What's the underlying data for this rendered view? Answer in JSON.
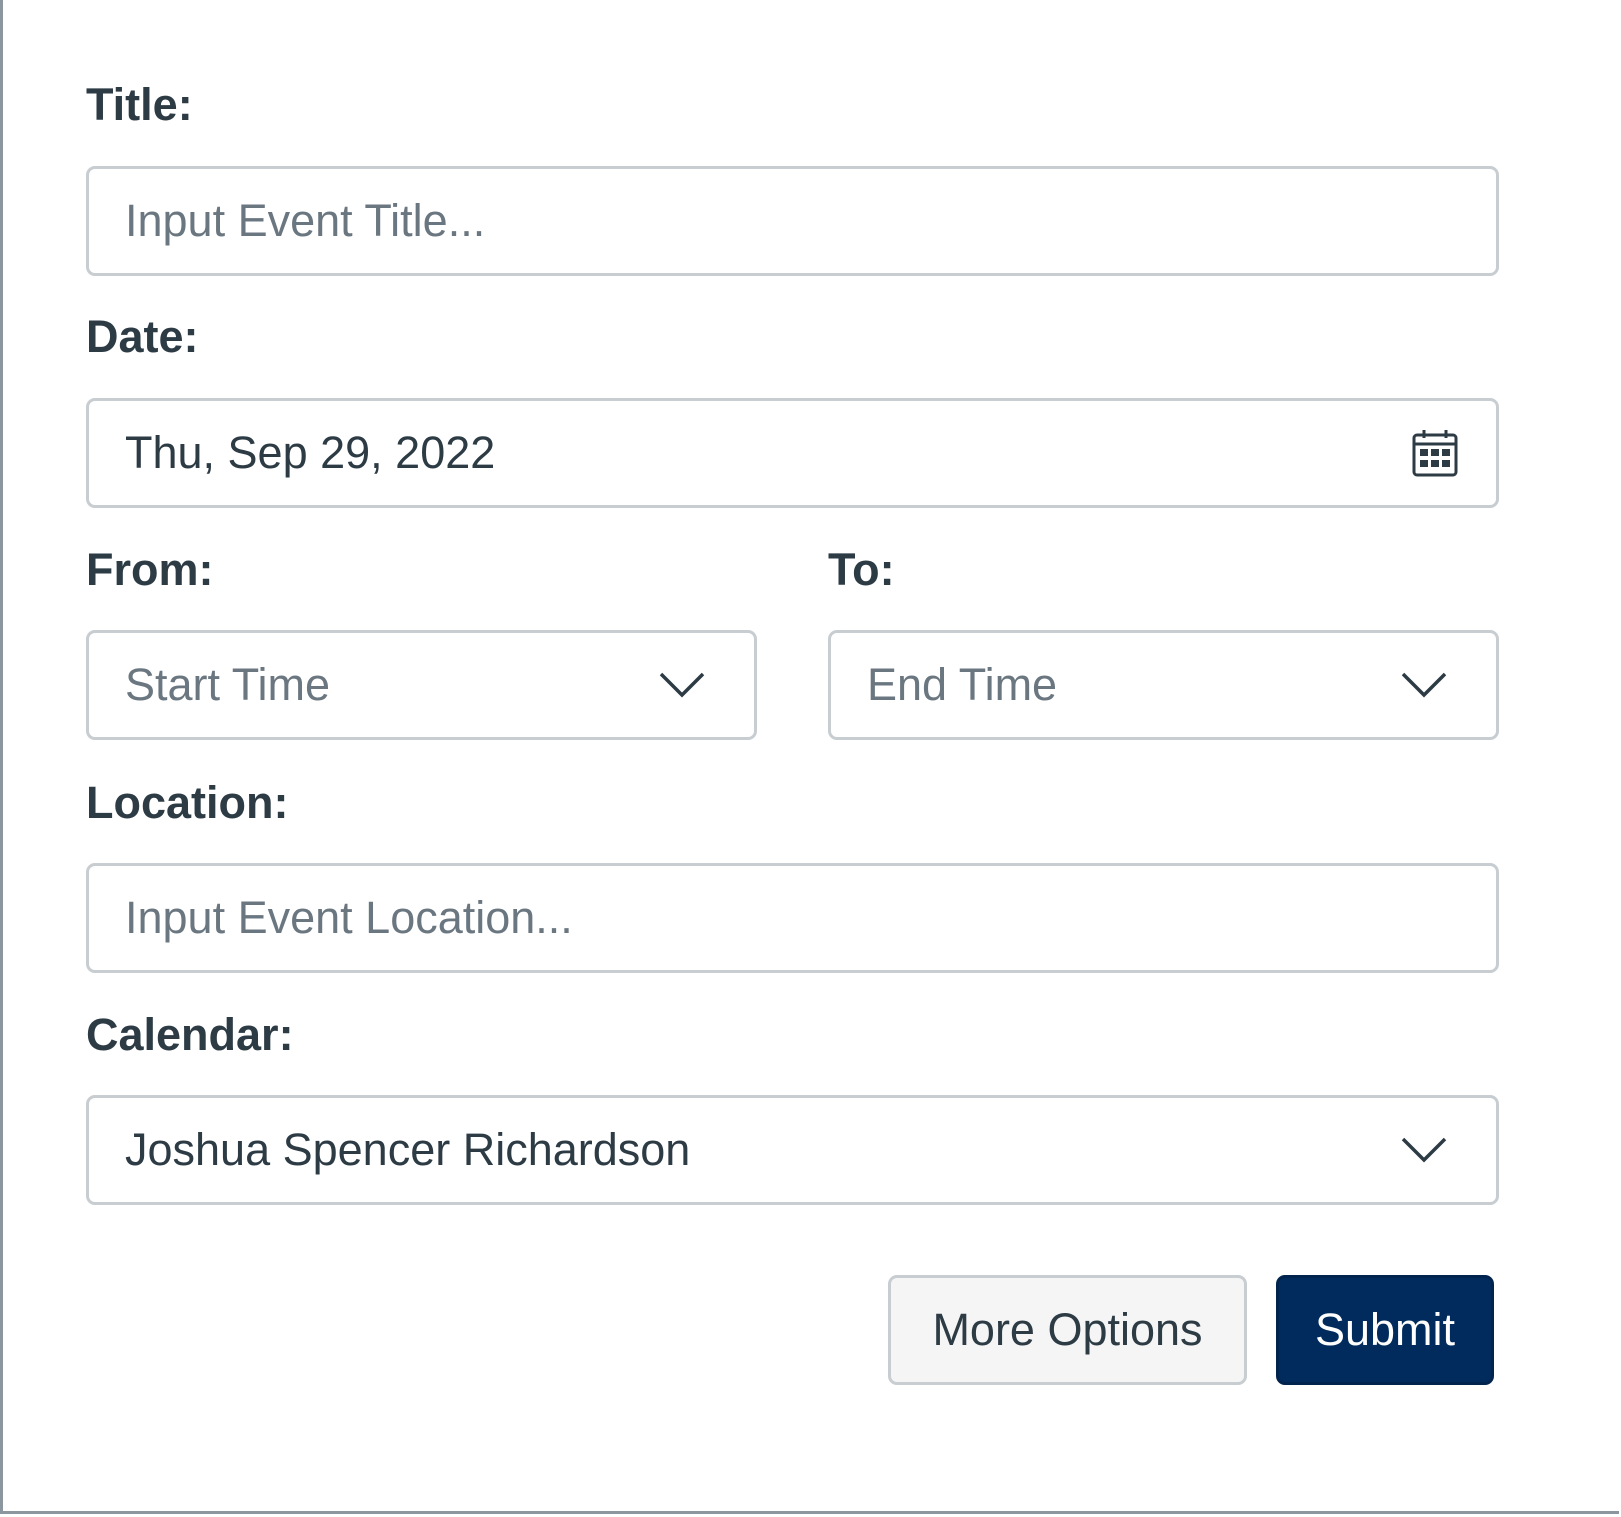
{
  "form": {
    "title_label": "Title:",
    "title_placeholder": "Input Event Title...",
    "date_label": "Date:",
    "date_value": "Thu, Sep 29, 2022",
    "from_label": "From:",
    "from_value": "Start Time",
    "to_label": "To:",
    "to_value": "End Time",
    "location_label": "Location:",
    "location_placeholder": "Input Event Location...",
    "calendar_label": "Calendar:",
    "calendar_value": "Joshua Spencer Richardson"
  },
  "actions": {
    "more_options_label": "More Options",
    "submit_label": "Submit"
  },
  "icons": {
    "date_icon": "calendar-icon",
    "select_icon": "chevron-down-icon"
  },
  "colors": {
    "primary_button": "#002b5c",
    "text": "#2d3b45",
    "placeholder": "#6b7780",
    "border": "#c7cdd1"
  }
}
